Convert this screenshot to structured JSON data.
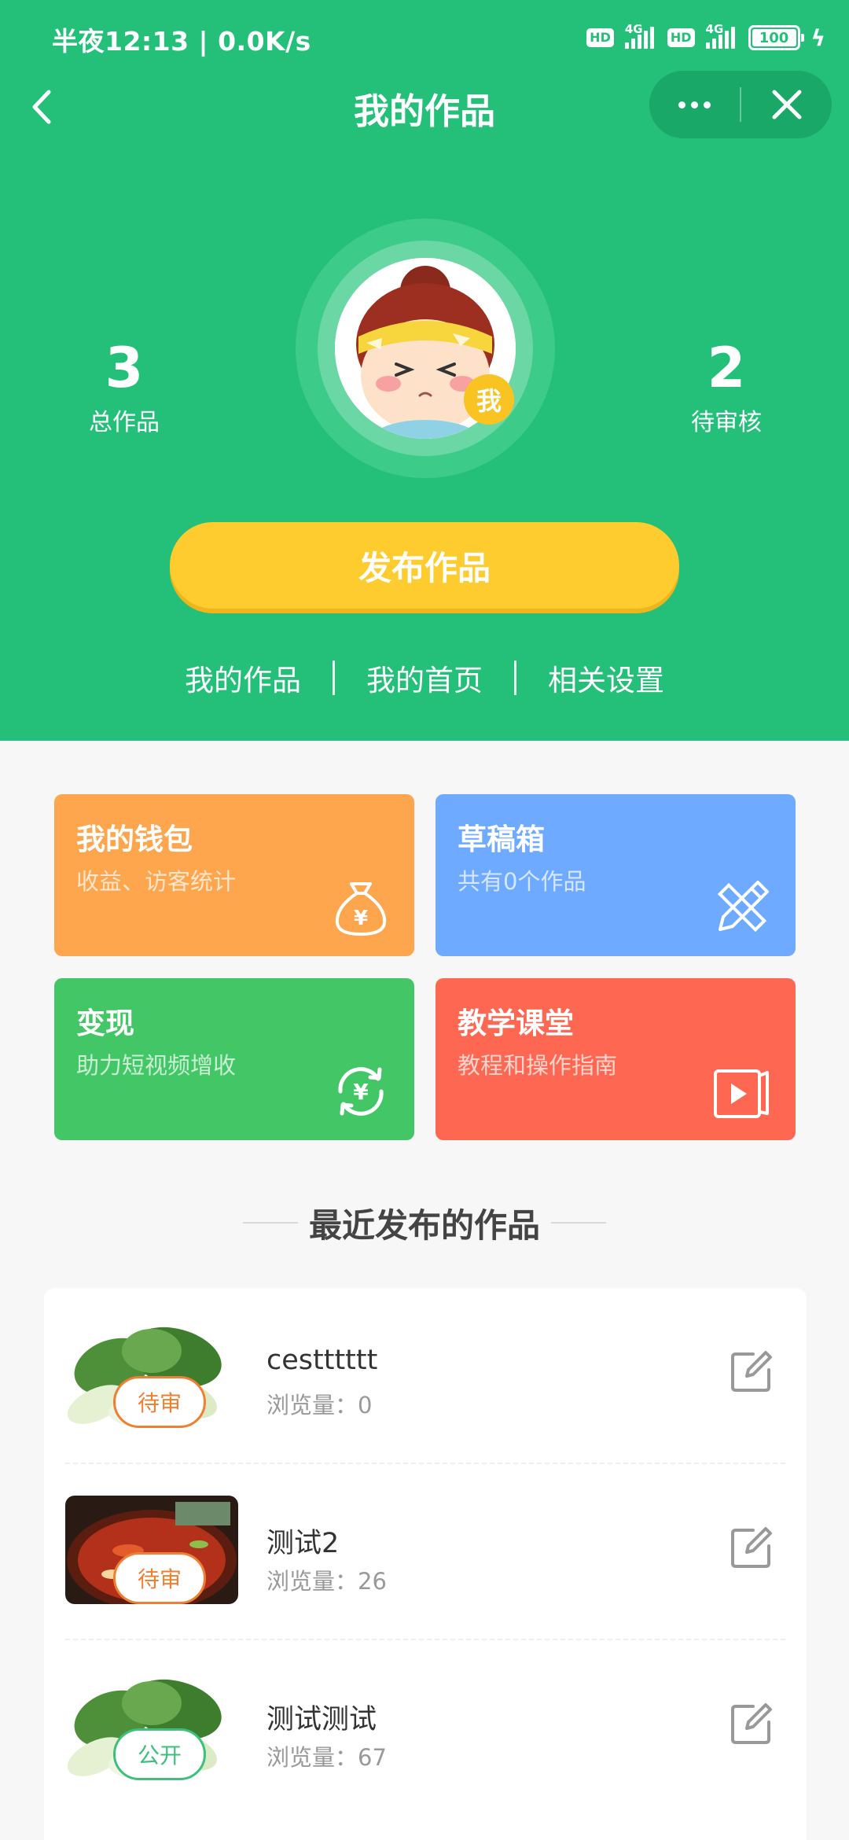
{
  "status_bar": {
    "text": "半夜12:13 | 0.0K/s",
    "hd": "HD",
    "net": "4G",
    "battery": "100"
  },
  "nav": {
    "title": "我的作品"
  },
  "stats": {
    "total_num": "3",
    "total_label": "总作品",
    "pending_num": "2",
    "pending_label": "待审核"
  },
  "avatar": {
    "badge": "我"
  },
  "publish_label": "发布作品",
  "links": [
    "我的作品",
    "我的首页",
    "相关设置"
  ],
  "cards": [
    {
      "title": "我的钱包",
      "subtitle": "收益、访客统计",
      "icon": "money-bag-icon",
      "color": "#fea64e"
    },
    {
      "title": "草稿箱",
      "subtitle": "共有0个作品",
      "icon": "pencil-ruler-icon",
      "color": "#6eaaff"
    },
    {
      "title": "变现",
      "subtitle": "助力短视频增收",
      "icon": "yuan-refresh-icon",
      "color": "#43c666"
    },
    {
      "title": "教学课堂",
      "subtitle": "教程和操作指南",
      "icon": "video-play-icon",
      "color": "#fe6751"
    }
  ],
  "section_title": "最近发布的作品",
  "works": [
    {
      "title": "cestttttt",
      "views": "浏览量：0",
      "status": "待审",
      "status_color": "#ef7f32",
      "thumb": "bok-choy"
    },
    {
      "title": "测试2",
      "views": "浏览量：26",
      "status": "待审",
      "status_color": "#ef7f32",
      "thumb": "hot-pot"
    },
    {
      "title": "测试测试",
      "views": "浏览量：67",
      "status": "公开",
      "status_color": "#3fbf7c",
      "thumb": "bok-choy"
    }
  ]
}
